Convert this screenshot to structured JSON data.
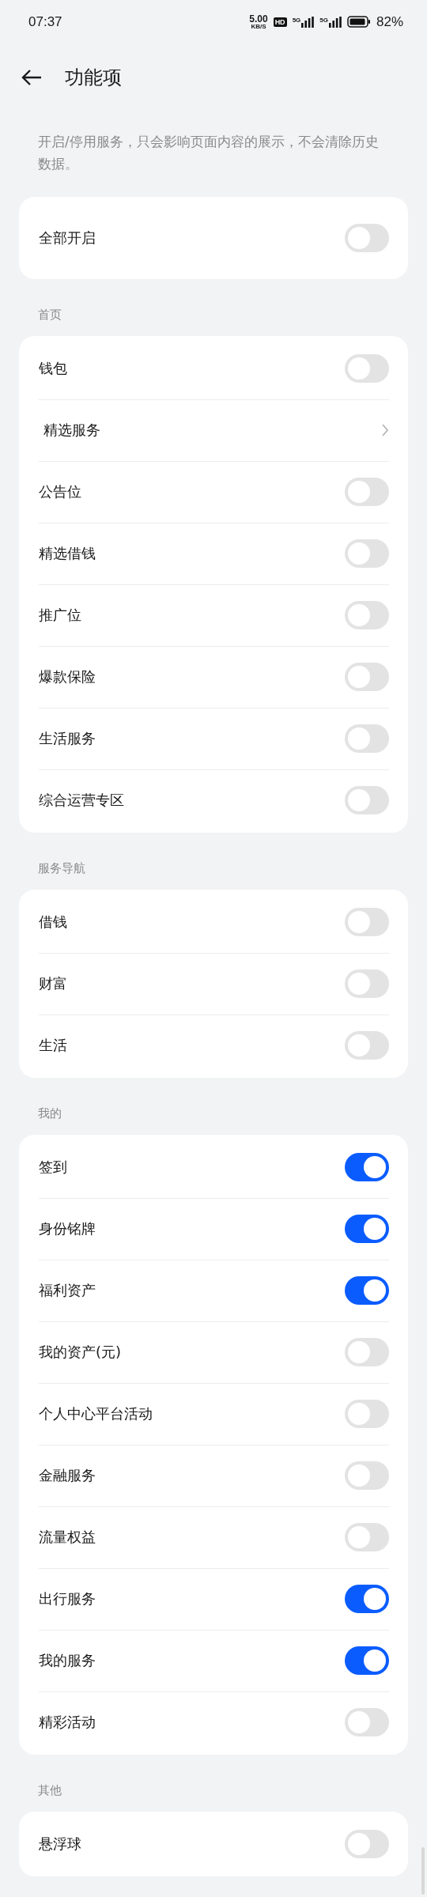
{
  "status_bar": {
    "time": "07:37",
    "net_speed": "5.00",
    "net_unit": "KB/S",
    "hd": "HD",
    "signals": [
      "5G",
      "5G"
    ],
    "battery": "82%"
  },
  "header": {
    "title": "功能项"
  },
  "description": "开启/停用服务，只会影响页面内容的展示，不会清除历史数据。",
  "master": {
    "label": "全部开启",
    "on": false
  },
  "sections": [
    {
      "title": "首页",
      "items": [
        {
          "kind": "toggle",
          "label": "钱包",
          "on": false
        },
        {
          "kind": "link",
          "label": "精选服务"
        },
        {
          "kind": "toggle",
          "label": "公告位",
          "on": false
        },
        {
          "kind": "toggle",
          "label": "精选借钱",
          "on": false
        },
        {
          "kind": "toggle",
          "label": "推广位",
          "on": false
        },
        {
          "kind": "toggle",
          "label": "爆款保险",
          "on": false
        },
        {
          "kind": "toggle",
          "label": "生活服务",
          "on": false
        },
        {
          "kind": "toggle",
          "label": "综合运营专区",
          "on": false
        }
      ]
    },
    {
      "title": "服务导航",
      "items": [
        {
          "kind": "toggle",
          "label": "借钱",
          "on": false
        },
        {
          "kind": "toggle",
          "label": "财富",
          "on": false
        },
        {
          "kind": "toggle",
          "label": "生活",
          "on": false
        }
      ]
    },
    {
      "title": "我的",
      "items": [
        {
          "kind": "toggle",
          "label": "签到",
          "on": true
        },
        {
          "kind": "toggle",
          "label": "身份铭牌",
          "on": true
        },
        {
          "kind": "toggle",
          "label": "福利资产",
          "on": true
        },
        {
          "kind": "toggle",
          "label": "我的资产(元)",
          "on": false
        },
        {
          "kind": "toggle",
          "label": "个人中心平台活动",
          "on": false
        },
        {
          "kind": "toggle",
          "label": "金融服务",
          "on": false
        },
        {
          "kind": "toggle",
          "label": "流量权益",
          "on": false
        },
        {
          "kind": "toggle",
          "label": "出行服务",
          "on": true
        },
        {
          "kind": "toggle",
          "label": "我的服务",
          "on": true
        },
        {
          "kind": "toggle",
          "label": "精彩活动",
          "on": false
        }
      ]
    },
    {
      "title": "其他",
      "items": [
        {
          "kind": "toggle",
          "label": "悬浮球",
          "on": false
        }
      ]
    }
  ]
}
